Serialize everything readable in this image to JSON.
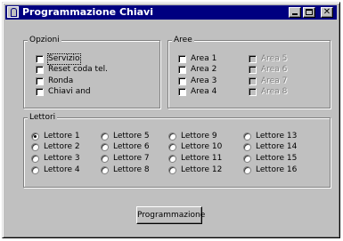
{
  "window": {
    "title": "Programmazione Chiavi"
  },
  "opzioni": {
    "title": "Opzioni",
    "items": [
      {
        "label": "Servizio",
        "checked": false,
        "focused": true
      },
      {
        "label": "Reset coda tel.",
        "checked": false
      },
      {
        "label": "Ronda",
        "checked": false
      },
      {
        "label": "Chiavi and",
        "checked": false
      }
    ]
  },
  "aree": {
    "title": "Aree",
    "items": [
      {
        "label": "Area 1",
        "enabled": true
      },
      {
        "label": "Area 2",
        "enabled": true
      },
      {
        "label": "Area 3",
        "enabled": true
      },
      {
        "label": "Area 4",
        "enabled": true
      },
      {
        "label": "Area 5",
        "enabled": false
      },
      {
        "label": "Area 6",
        "enabled": false
      },
      {
        "label": "Area 7",
        "enabled": false
      },
      {
        "label": "Area 8",
        "enabled": false
      }
    ]
  },
  "lettori": {
    "title": "Lettori",
    "selected": "Lettore 1",
    "items": [
      "Lettore 1",
      "Lettore 2",
      "Lettore 3",
      "Lettore 4",
      "Lettore 5",
      "Lettore 6",
      "Lettore 7",
      "Lettore 8",
      "Lettore 9",
      "Lettore 10",
      "Lettore 11",
      "Lettore 12",
      "Lettore 13",
      "Lettore 14",
      "Lettore 15",
      "Lettore 16"
    ]
  },
  "button": {
    "label": "Programmazione"
  }
}
